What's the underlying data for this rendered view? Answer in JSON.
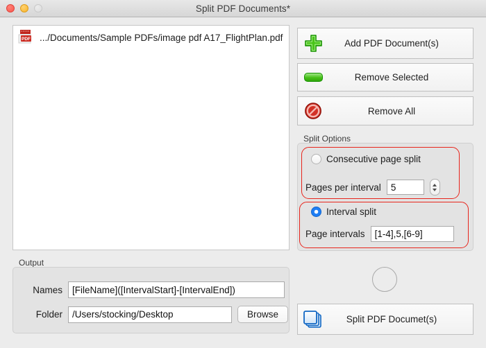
{
  "window": {
    "title": "Split PDF Documents*",
    "traffic_lights": [
      "close",
      "minimize",
      "zoom"
    ]
  },
  "file_list": {
    "items": [
      {
        "icon": "pdf-file-icon",
        "name": ".../Documents/Sample PDFs/image pdf A17_FlightPlan.pdf"
      }
    ]
  },
  "actions": {
    "add": {
      "label": "Add PDF Document(s)",
      "icon": "green-plus-icon"
    },
    "remove_selected": {
      "label": "Remove Selected",
      "icon": "green-minus-icon"
    },
    "remove_all": {
      "label": "Remove All",
      "icon": "red-no-entry-icon"
    },
    "split": {
      "label": "Split PDF Documet(s)",
      "icon": "blue-pages-icon"
    }
  },
  "split_options": {
    "group_label": "Split Options",
    "consecutive": {
      "radio_label": "Consecutive page split",
      "selected": false,
      "field_label": "Pages per interval",
      "value": "5"
    },
    "interval": {
      "radio_label": "Interval split",
      "selected": true,
      "field_label": "Page intervals",
      "value": "[1-4],5,[6-9]"
    }
  },
  "output": {
    "group_label": "Output",
    "names_label": "Names",
    "names_value": "[FileName]([IntervalStart]-[IntervalEnd])",
    "folder_label": "Folder",
    "folder_value": "/Users/stocking/Desktop",
    "browse_label": "Browse"
  },
  "colors": {
    "accent_blue": "#1f7ef4",
    "highlight_red": "#e8241b",
    "icon_green": "#46c017",
    "icon_red": "#cc2a21",
    "window_bg": "#ececec"
  }
}
